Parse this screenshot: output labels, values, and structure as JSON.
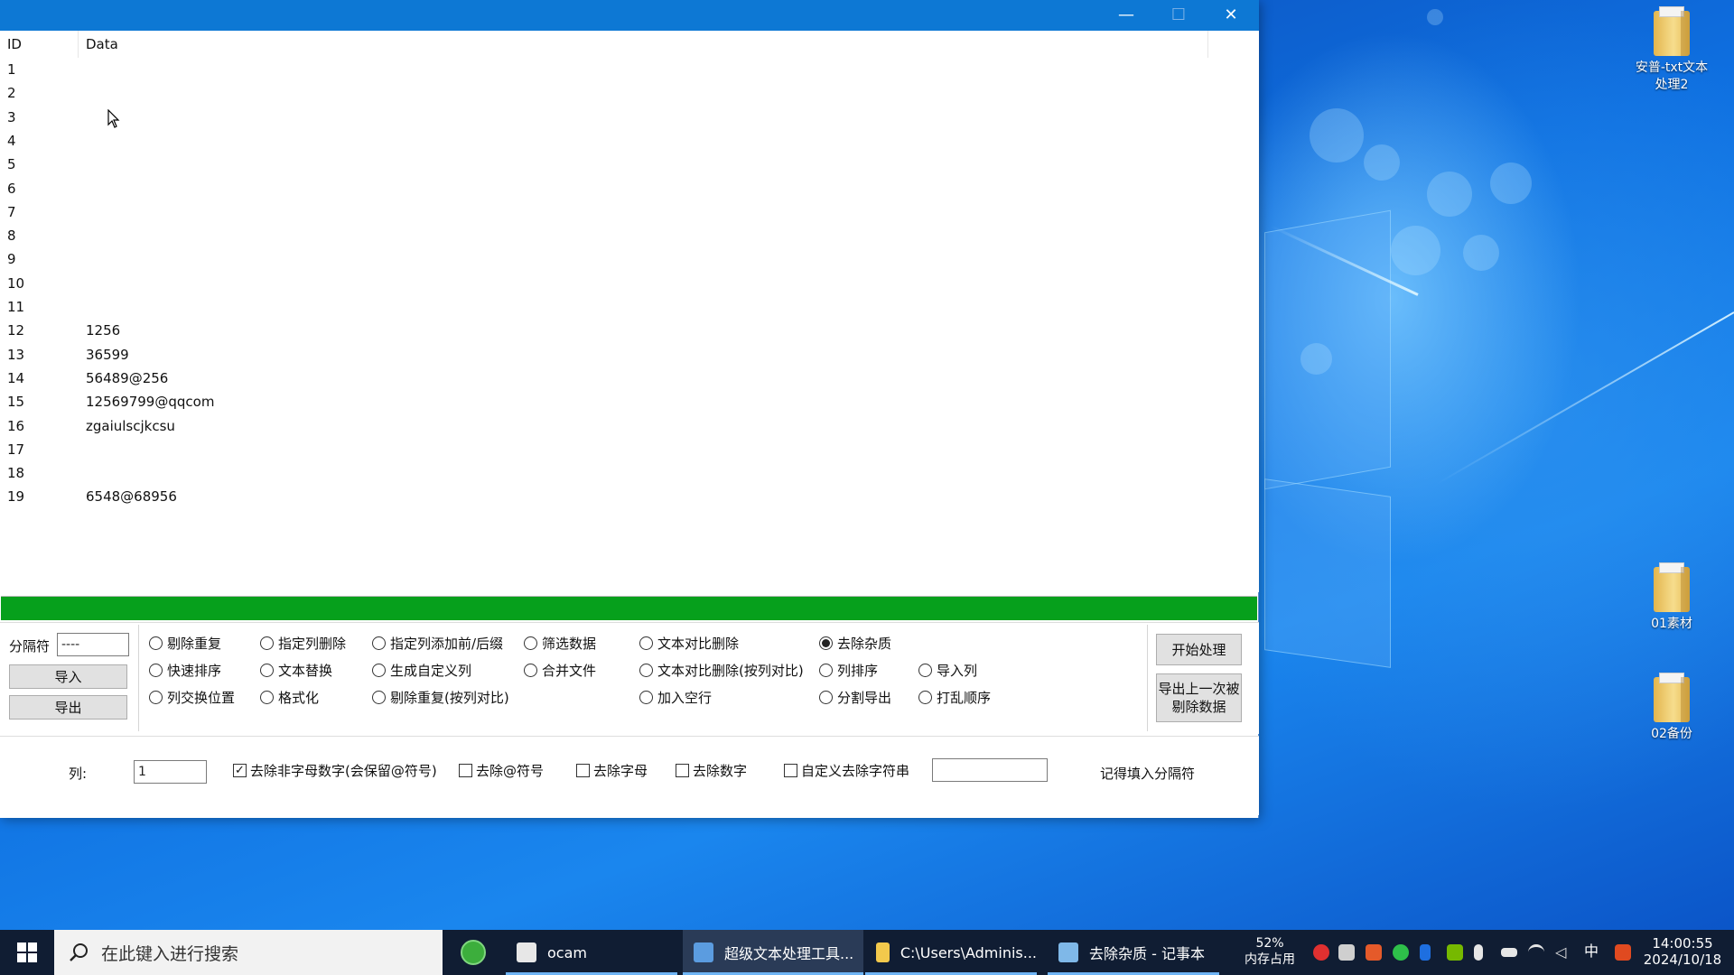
{
  "window": {
    "close_glyph": "✕",
    "minimize_glyph": "—",
    "maximize_glyph": "☐"
  },
  "grid": {
    "columns": [
      "ID",
      "Data"
    ],
    "rows": [
      {
        "id": "1",
        "data": ""
      },
      {
        "id": "2",
        "data": ""
      },
      {
        "id": "3",
        "data": ""
      },
      {
        "id": "4",
        "data": ""
      },
      {
        "id": "5",
        "data": ""
      },
      {
        "id": "6",
        "data": ""
      },
      {
        "id": "7",
        "data": ""
      },
      {
        "id": "8",
        "data": ""
      },
      {
        "id": "9",
        "data": ""
      },
      {
        "id": "10",
        "data": ""
      },
      {
        "id": "11",
        "data": ""
      },
      {
        "id": "12",
        "data": "1256"
      },
      {
        "id": "13",
        "data": "36599"
      },
      {
        "id": "14",
        "data": "56489@256"
      },
      {
        "id": "15",
        "data": "12569799@qqcom"
      },
      {
        "id": "16",
        "data": "zgaiulscjkcsu"
      },
      {
        "id": "17",
        "data": ""
      },
      {
        "id": "18",
        "data": ""
      },
      {
        "id": "19",
        "data": "6548@68956"
      }
    ]
  },
  "progress": {
    "value": 1.0,
    "color": "#06a01c"
  },
  "left_panel": {
    "separator_label": "分隔符",
    "separator_value": "----",
    "import_label": "导入",
    "export_label": "导出"
  },
  "radios": [
    {
      "label": "剔除重复",
      "checked": false
    },
    {
      "label": "指定列删除",
      "checked": false
    },
    {
      "label": "指定列添加前/后缀",
      "checked": false
    },
    {
      "label": "筛选数据",
      "checked": false
    },
    {
      "label": "文本对比删除",
      "checked": false
    },
    {
      "label": "去除杂质",
      "checked": true
    },
    {
      "label": "快速排序",
      "checked": false
    },
    {
      "label": "文本替换",
      "checked": false
    },
    {
      "label": "生成自定义列",
      "checked": false
    },
    {
      "label": "合并文件",
      "checked": false
    },
    {
      "label": "文本对比删除(按列对比)",
      "checked": false
    },
    {
      "label": "列排序",
      "checked": false
    },
    {
      "label": "导入列",
      "checked": false
    },
    {
      "label": "列交换位置",
      "checked": false
    },
    {
      "label": "格式化",
      "checked": false
    },
    {
      "label": "剔除重复(按列对比)",
      "checked": false
    },
    {
      "label": "加入空行",
      "checked": false
    },
    {
      "label": "分割导出",
      "checked": false
    },
    {
      "label": "打乱顺序",
      "checked": false
    }
  ],
  "right_buttons": {
    "start_label": "开始处理",
    "export_removed_line1": "导出上一次被",
    "export_removed_line2": "剔除数据"
  },
  "bottom": {
    "column_label": "列:",
    "column_value": "1",
    "checks": [
      {
        "label": "去除非字母数字(会保留@符号)",
        "checked": true
      },
      {
        "label": "去除@符号",
        "checked": false
      },
      {
        "label": "去除字母",
        "checked": false
      },
      {
        "label": "去除数字",
        "checked": false
      },
      {
        "label": "自定义去除字符串",
        "checked": false
      }
    ],
    "custom_value": "",
    "hint": "记得填入分隔符"
  },
  "desktop": {
    "icons": [
      {
        "line1": "安普-txt文本",
        "line2": "处理2"
      },
      {
        "line1": "01素材",
        "line2": ""
      },
      {
        "line1": "02备份",
        "line2": ""
      }
    ]
  },
  "taskbar": {
    "search_placeholder": "在此键入进行搜索",
    "apps": [
      {
        "label": "ocam",
        "icon": "ocam-icon"
      },
      {
        "label": "超级文本处理工具...",
        "icon": "app-icon"
      },
      {
        "label": "C:\\Users\\Adminis...",
        "icon": "folder-icon"
      },
      {
        "label": "去除杂质 - 记事本",
        "icon": "notepad-icon"
      }
    ],
    "memory_percent": "52%",
    "memory_label": "内存占用",
    "ime": "中",
    "time": "14:00:55",
    "date": "2024/10/18"
  }
}
